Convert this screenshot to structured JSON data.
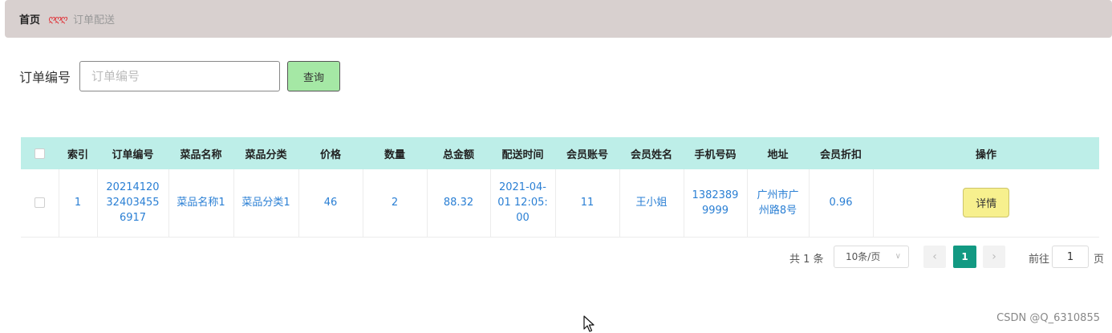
{
  "breadcrumb": {
    "home": "首页",
    "separator": "ღღღ",
    "current": "订单配送"
  },
  "search": {
    "label": "订单编号",
    "placeholder": "订单编号",
    "button": "查询"
  },
  "table": {
    "headers": [
      "",
      "索引",
      "订单编号",
      "菜品名称",
      "菜品分类",
      "价格",
      "数量",
      "总金额",
      "配送时间",
      "会员账号",
      "会员姓名",
      "手机号码",
      "地址",
      "会员折扣",
      "操作"
    ],
    "rows": [
      {
        "index": "1",
        "order_no": "20214120 32403455 6917",
        "dish_name": "菜品名称1",
        "dish_category": "菜品分类1",
        "price": "46",
        "quantity": "2",
        "total": "88.32",
        "delivery_time": "2021-04- 01 12:05: 00",
        "member_account": "11",
        "member_name": "王小姐",
        "phone": "1382389 9999",
        "address": "广州市广 州路8号",
        "discount": "0.96",
        "action": "详情"
      }
    ]
  },
  "pagination": {
    "total": "共 1 条",
    "page_size": "10条/页",
    "current_page": "1",
    "goto_label": "前往",
    "goto_value": "1",
    "goto_unit": "页",
    "prev": "‹",
    "next": "›"
  },
  "watermark": "CSDN @Q_6310855",
  "colors": {
    "header_bg": "#bdeee8",
    "page_active": "#129982",
    "detail_btn": "#f7f08e",
    "search_btn": "#a5e8a5",
    "link": "#2a7fd4"
  }
}
